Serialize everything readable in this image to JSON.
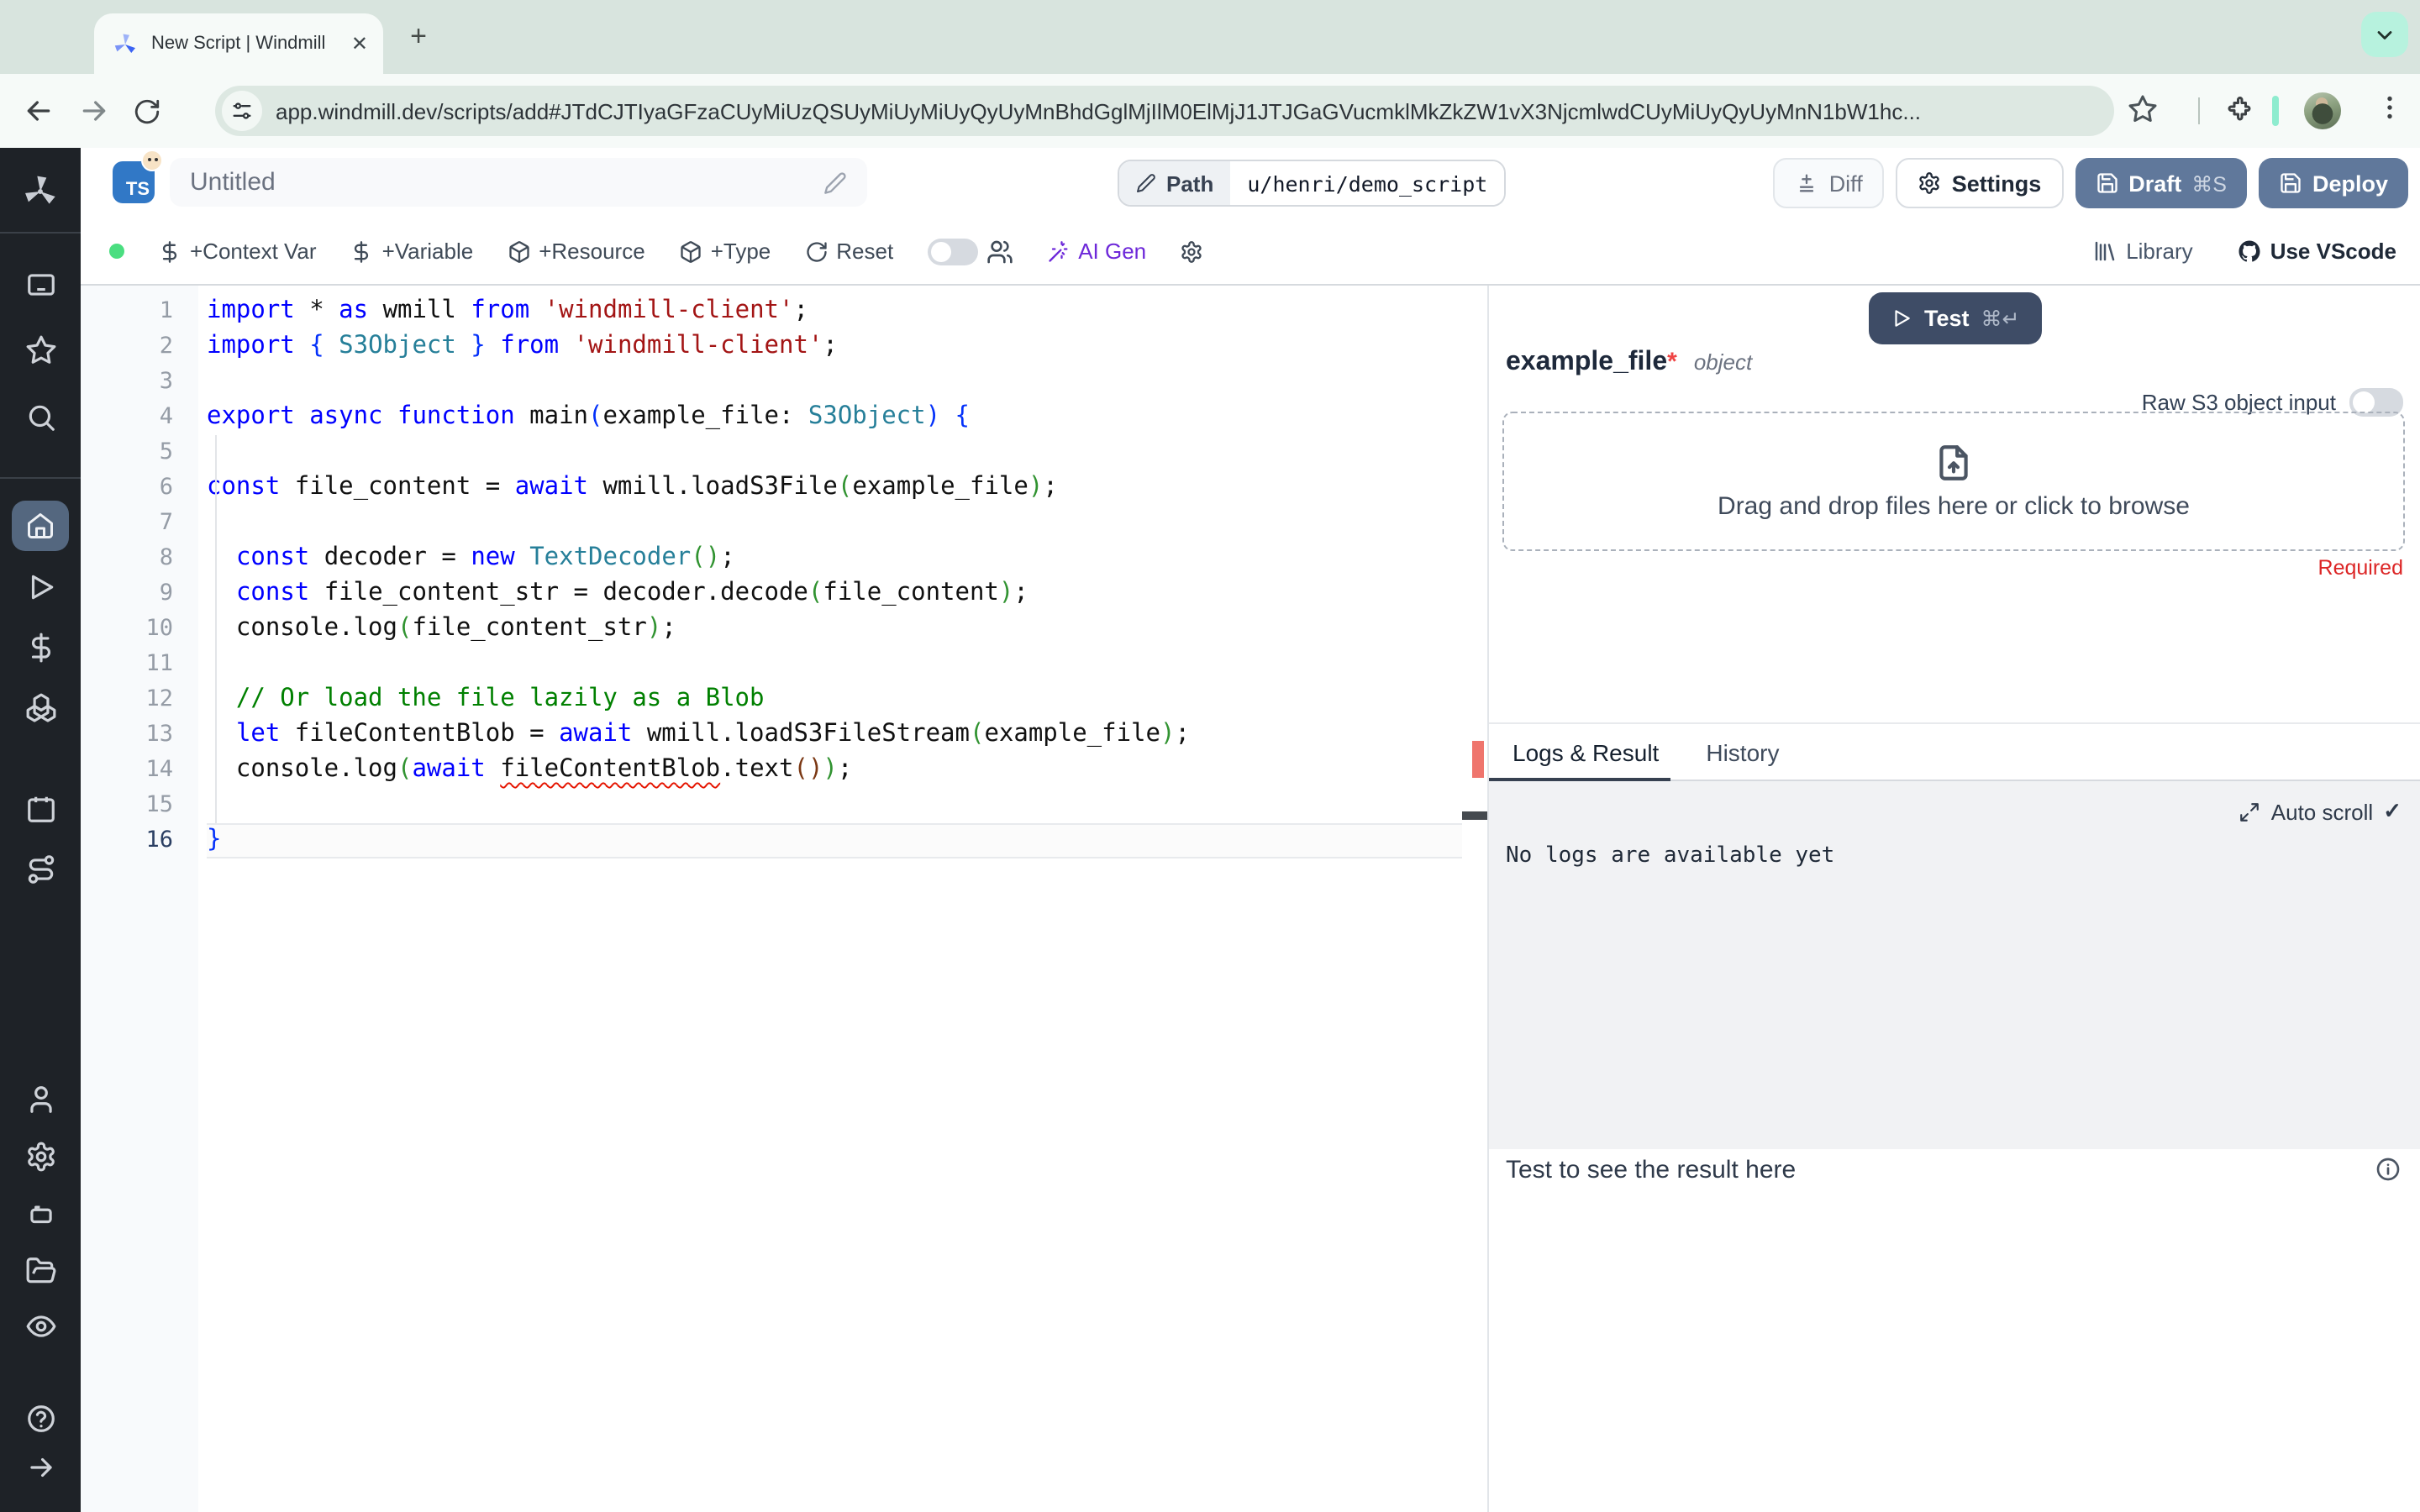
{
  "browser": {
    "tab_title": "New Script | Windmill",
    "url": "app.windmill.dev/scripts/add#JTdCJTIyaGFzaCUyMiUzQSUyMiUyMiUyQyUyMnBhdGglMjIlM0ElMjJ1JTJGaGVucmklMkZkZW1vX3NjcmlwdCUyMiUyQyUyMnN1bW1hc..."
  },
  "header": {
    "lang_badge": "TS",
    "title_value": "Untitled",
    "path_label": "Path",
    "path_value": "u/henri/demo_script",
    "diff_label": "Diff",
    "settings_label": "Settings",
    "draft_label": "Draft",
    "draft_shortcut": "⌘S",
    "deploy_label": "Deploy"
  },
  "toolbar": {
    "context_var": "+Context Var",
    "variable": "+Variable",
    "resource": "+Resource",
    "type": "+Type",
    "reset": "Reset",
    "ai_gen": "AI Gen",
    "library": "Library",
    "vscode": "Use VScode"
  },
  "sidebar": {
    "icons_top": [
      "windmill-logo",
      "app-window",
      "star",
      "search"
    ],
    "icons_mid": [
      "home",
      "runs-play",
      "variables-dollar",
      "resources-boxes",
      "schedules-calendar",
      "flows-route"
    ],
    "icons_bottom": [
      "user",
      "settings-gear",
      "workers-robot",
      "folders",
      "audit-eye",
      "help",
      "expand-arrow"
    ],
    "active_item": "home"
  },
  "editor": {
    "active_line": 16,
    "lines": [
      [
        [
          "import ",
          "k"
        ],
        [
          "* ",
          "d"
        ],
        [
          "as ",
          "k"
        ],
        [
          "wmill ",
          "d"
        ],
        [
          "from ",
          "k"
        ],
        [
          "'windmill-client'",
          "s"
        ],
        [
          ";",
          "d"
        ]
      ],
      [
        [
          "import ",
          "k"
        ],
        [
          "{ ",
          "b1"
        ],
        [
          "S3Object",
          "t"
        ],
        [
          " }",
          "b1"
        ],
        [
          " ",
          "d"
        ],
        [
          "from ",
          "k"
        ],
        [
          "'windmill-client'",
          "s"
        ],
        [
          ";",
          "d"
        ]
      ],
      [],
      [
        [
          "export ",
          "k"
        ],
        [
          "async ",
          "k"
        ],
        [
          "function ",
          "k"
        ],
        [
          "main",
          "d"
        ],
        [
          "(",
          "b1"
        ],
        [
          "example_file: ",
          "d"
        ],
        [
          "S3Object",
          "t"
        ],
        [
          ")",
          "b1"
        ],
        [
          " ",
          "d"
        ],
        [
          "{",
          "b1"
        ]
      ],
      [],
      [
        [
          "const ",
          "k"
        ],
        [
          "file_content = ",
          "d"
        ],
        [
          "await ",
          "k"
        ],
        [
          "wmill.loadS3File",
          "d"
        ],
        [
          "(",
          "b2"
        ],
        [
          "example_file",
          "d"
        ],
        [
          ")",
          "b2"
        ],
        [
          ";",
          "d"
        ]
      ],
      [],
      [
        [
          "  ",
          "d"
        ],
        [
          "const ",
          "k"
        ],
        [
          "decoder = ",
          "d"
        ],
        [
          "new ",
          "k"
        ],
        [
          "TextDecoder",
          "t"
        ],
        [
          "(",
          "b2"
        ],
        [
          ")",
          "b2"
        ],
        [
          ";",
          "d"
        ]
      ],
      [
        [
          "  ",
          "d"
        ],
        [
          "const ",
          "k"
        ],
        [
          "file_content_str = decoder.decode",
          "d"
        ],
        [
          "(",
          "b2"
        ],
        [
          "file_content",
          "d"
        ],
        [
          ")",
          "b2"
        ],
        [
          ";",
          "d"
        ]
      ],
      [
        [
          "  console.log",
          "d"
        ],
        [
          "(",
          "b2"
        ],
        [
          "file_content_str",
          "d"
        ],
        [
          ")",
          "b2"
        ],
        [
          ";",
          "d"
        ]
      ],
      [],
      [
        [
          "  // Or load the file lazily as a Blob",
          "c"
        ]
      ],
      [
        [
          "  ",
          "d"
        ],
        [
          "let ",
          "k"
        ],
        [
          "fileContentBlob = ",
          "d"
        ],
        [
          "await ",
          "k"
        ],
        [
          "wmill.loadS3FileStream",
          "d"
        ],
        [
          "(",
          "b2"
        ],
        [
          "example_file",
          "d"
        ],
        [
          ")",
          "b2"
        ],
        [
          ";",
          "d"
        ]
      ],
      [
        [
          "  console.log",
          "d"
        ],
        [
          "(",
          "b2"
        ],
        [
          "await ",
          "k"
        ],
        [
          "fileContentBlob",
          "w"
        ],
        [
          ".text",
          "d"
        ],
        [
          "(",
          "b3"
        ],
        [
          ")",
          "b3"
        ],
        [
          ")",
          "b2"
        ],
        [
          ";",
          "d"
        ]
      ],
      [],
      [
        [
          "}",
          "b1"
        ]
      ]
    ]
  },
  "panel": {
    "test_label": "Test",
    "test_shortcut": "⌘↵",
    "arg_name": "example_file",
    "arg_required_star": "*",
    "arg_type": "object",
    "raw_s3_label": "Raw S3 object input",
    "dropzone_text": "Drag and drop files here or click to browse",
    "required_label": "Required",
    "tab_logs": "Logs & Result",
    "tab_history": "History",
    "autoscroll_label": "Auto scroll",
    "autoscroll_check": "✓",
    "no_logs": "No logs are available yet",
    "result_placeholder": "Test to see the result here"
  },
  "colors": {
    "accent_button": "#60789b",
    "test_button": "#3e4c66",
    "ai_gen": "#6d28d9",
    "required_red": "#dc2626",
    "green_status_dot": "#4ade80",
    "chrome_mint": "#b7f2de",
    "sidebar_bg": "#1e2227",
    "error_marker": "#ef756d"
  }
}
